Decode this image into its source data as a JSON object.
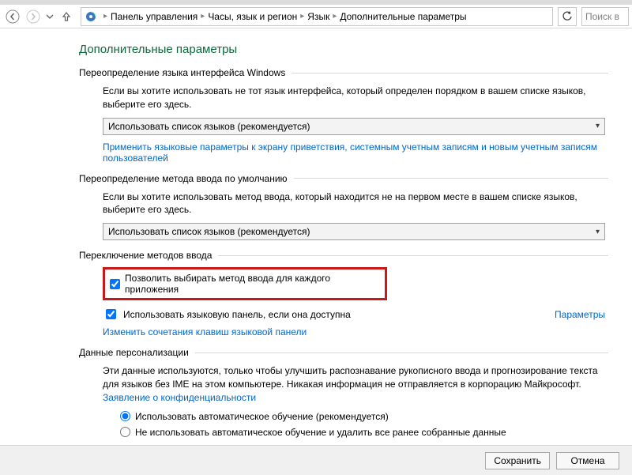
{
  "nav": {
    "breadcrumb": [
      "Панель управления",
      "Часы, язык и регион",
      "Язык",
      "Дополнительные параметры"
    ],
    "search_placeholder": "Поиск в"
  },
  "page": {
    "title": "Дополнительные параметры"
  },
  "section_override_lang": {
    "heading": "Переопределение языка интерфейса Windows",
    "desc": "Если вы хотите использовать не тот язык интерфейса, который определен порядком в вашем списке языков, выберите его здесь.",
    "combo_value": "Использовать список языков (рекомендуется)",
    "link": "Применить языковые параметры к экрану приветствия, системным учетным записям и новым учетным записям пользователей"
  },
  "section_override_input": {
    "heading": "Переопределение метода ввода по умолчанию",
    "desc": "Если вы хотите использовать метод ввода, который находится не на первом месте в вашем списке языков, выберите его здесь.",
    "combo_value": "Использовать список языков (рекомендуется)"
  },
  "section_switching": {
    "heading": "Переключение методов ввода",
    "check_per_app": "Позволить выбирать метод ввода для каждого приложения",
    "check_per_app_checked": true,
    "check_lang_bar": "Использовать языковую панель, если она доступна",
    "check_lang_bar_checked": true,
    "options_link": "Параметры",
    "shortcuts_link": "Изменить сочетания клавиш языковой панели"
  },
  "section_personal": {
    "heading": "Данные персонализации",
    "desc": "Эти данные используются, только чтобы улучшить распознавание рукописного ввода и прогнозирование текста для языков без IME на этом компьютере. Никакая информация не отправляется в корпорацию Майкрософт.",
    "privacy_link": "Заявление о конфиденциальности",
    "radio_auto": "Использовать автоматическое обучение (рекомендуется)",
    "radio_off": "Не использовать автоматическое обучение и удалить все ранее собранные данные",
    "radio_selected": "auto"
  },
  "buttons": {
    "save": "Сохранить",
    "cancel": "Отмена"
  }
}
